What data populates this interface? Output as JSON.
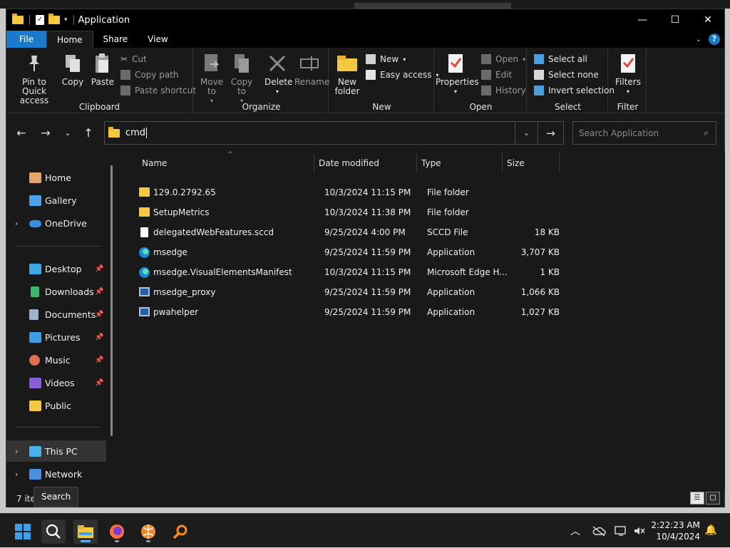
{
  "window": {
    "title": "Application",
    "controls": {
      "minimize": "—",
      "maximize": "☐",
      "close": "✕"
    }
  },
  "ribbon_tabs": [
    "File",
    "Home",
    "Share",
    "View"
  ],
  "ribbon": {
    "clipboard": {
      "label": "Clipboard",
      "pin": "Pin to Quick access",
      "copy": "Copy",
      "paste": "Paste",
      "cut": "Cut",
      "copy_path": "Copy path",
      "paste_shortcut": "Paste shortcut"
    },
    "organize": {
      "label": "Organize",
      "move_to": "Move to",
      "copy_to": "Copy to",
      "delete": "Delete",
      "rename": "Rename"
    },
    "new": {
      "label": "New",
      "new_folder": "New folder",
      "new_item": "New",
      "easy_access": "Easy access"
    },
    "open": {
      "label": "Open",
      "properties": "Properties",
      "open": "Open",
      "edit": "Edit",
      "history": "History"
    },
    "select": {
      "label": "Select",
      "select_all": "Select all",
      "select_none": "Select none",
      "invert": "Invert selection"
    },
    "filter": {
      "label": "Filter",
      "filters": "Filters"
    }
  },
  "address": {
    "value": "cmd"
  },
  "search": {
    "placeholder": "Search Application"
  },
  "sidebar": {
    "items": [
      {
        "label": "Home",
        "color": "#e8a56a"
      },
      {
        "label": "Gallery",
        "color": "#4aa3e6"
      },
      {
        "label": "OneDrive",
        "color": "#3b8fe0"
      },
      {
        "label": "Desktop",
        "color": "#3fa7e8"
      },
      {
        "label": "Downloads",
        "color": "#3fb56c"
      },
      {
        "label": "Documents",
        "color": "#9fb4c8"
      },
      {
        "label": "Pictures",
        "color": "#3b9fe0"
      },
      {
        "label": "Music",
        "color": "#e07050"
      },
      {
        "label": "Videos",
        "color": "#8a5cd6"
      },
      {
        "label": "Public",
        "color": "#f5c842"
      },
      {
        "label": "This PC",
        "color": "#4ab0e8"
      },
      {
        "label": "Network",
        "color": "#4a8ee0"
      }
    ]
  },
  "columns": {
    "name": "Name",
    "date": "Date modified",
    "type": "Type",
    "size": "Size"
  },
  "files": [
    {
      "name": "129.0.2792.65",
      "date": "10/3/2024 11:15 PM",
      "type": "File folder",
      "size": ""
    },
    {
      "name": "SetupMetrics",
      "date": "10/3/2024 11:38 PM",
      "type": "File folder",
      "size": ""
    },
    {
      "name": "delegatedWebFeatures.sccd",
      "date": "9/25/2024 4:00 PM",
      "type": "SCCD File",
      "size": "18 KB"
    },
    {
      "name": "msedge",
      "date": "9/25/2024 11:59 PM",
      "type": "Application",
      "size": "3,707 KB"
    },
    {
      "name": "msedge.VisualElementsManifest",
      "date": "10/3/2024 11:15 PM",
      "type": "Microsoft Edge H...",
      "size": "1 KB"
    },
    {
      "name": "msedge_proxy",
      "date": "9/25/2024 11:59 PM",
      "type": "Application",
      "size": "1,066 KB"
    },
    {
      "name": "pwahelper",
      "date": "9/25/2024 11:59 PM",
      "type": "Application",
      "size": "1,027 KB"
    }
  ],
  "status": {
    "count": "7 ite",
    "tooltip": "Search"
  },
  "taskbar": {
    "time": "2:22:23 AM",
    "date": "10/4/2024"
  },
  "colors": {
    "accent": "#1979ca",
    "folder": "#f5c842"
  }
}
